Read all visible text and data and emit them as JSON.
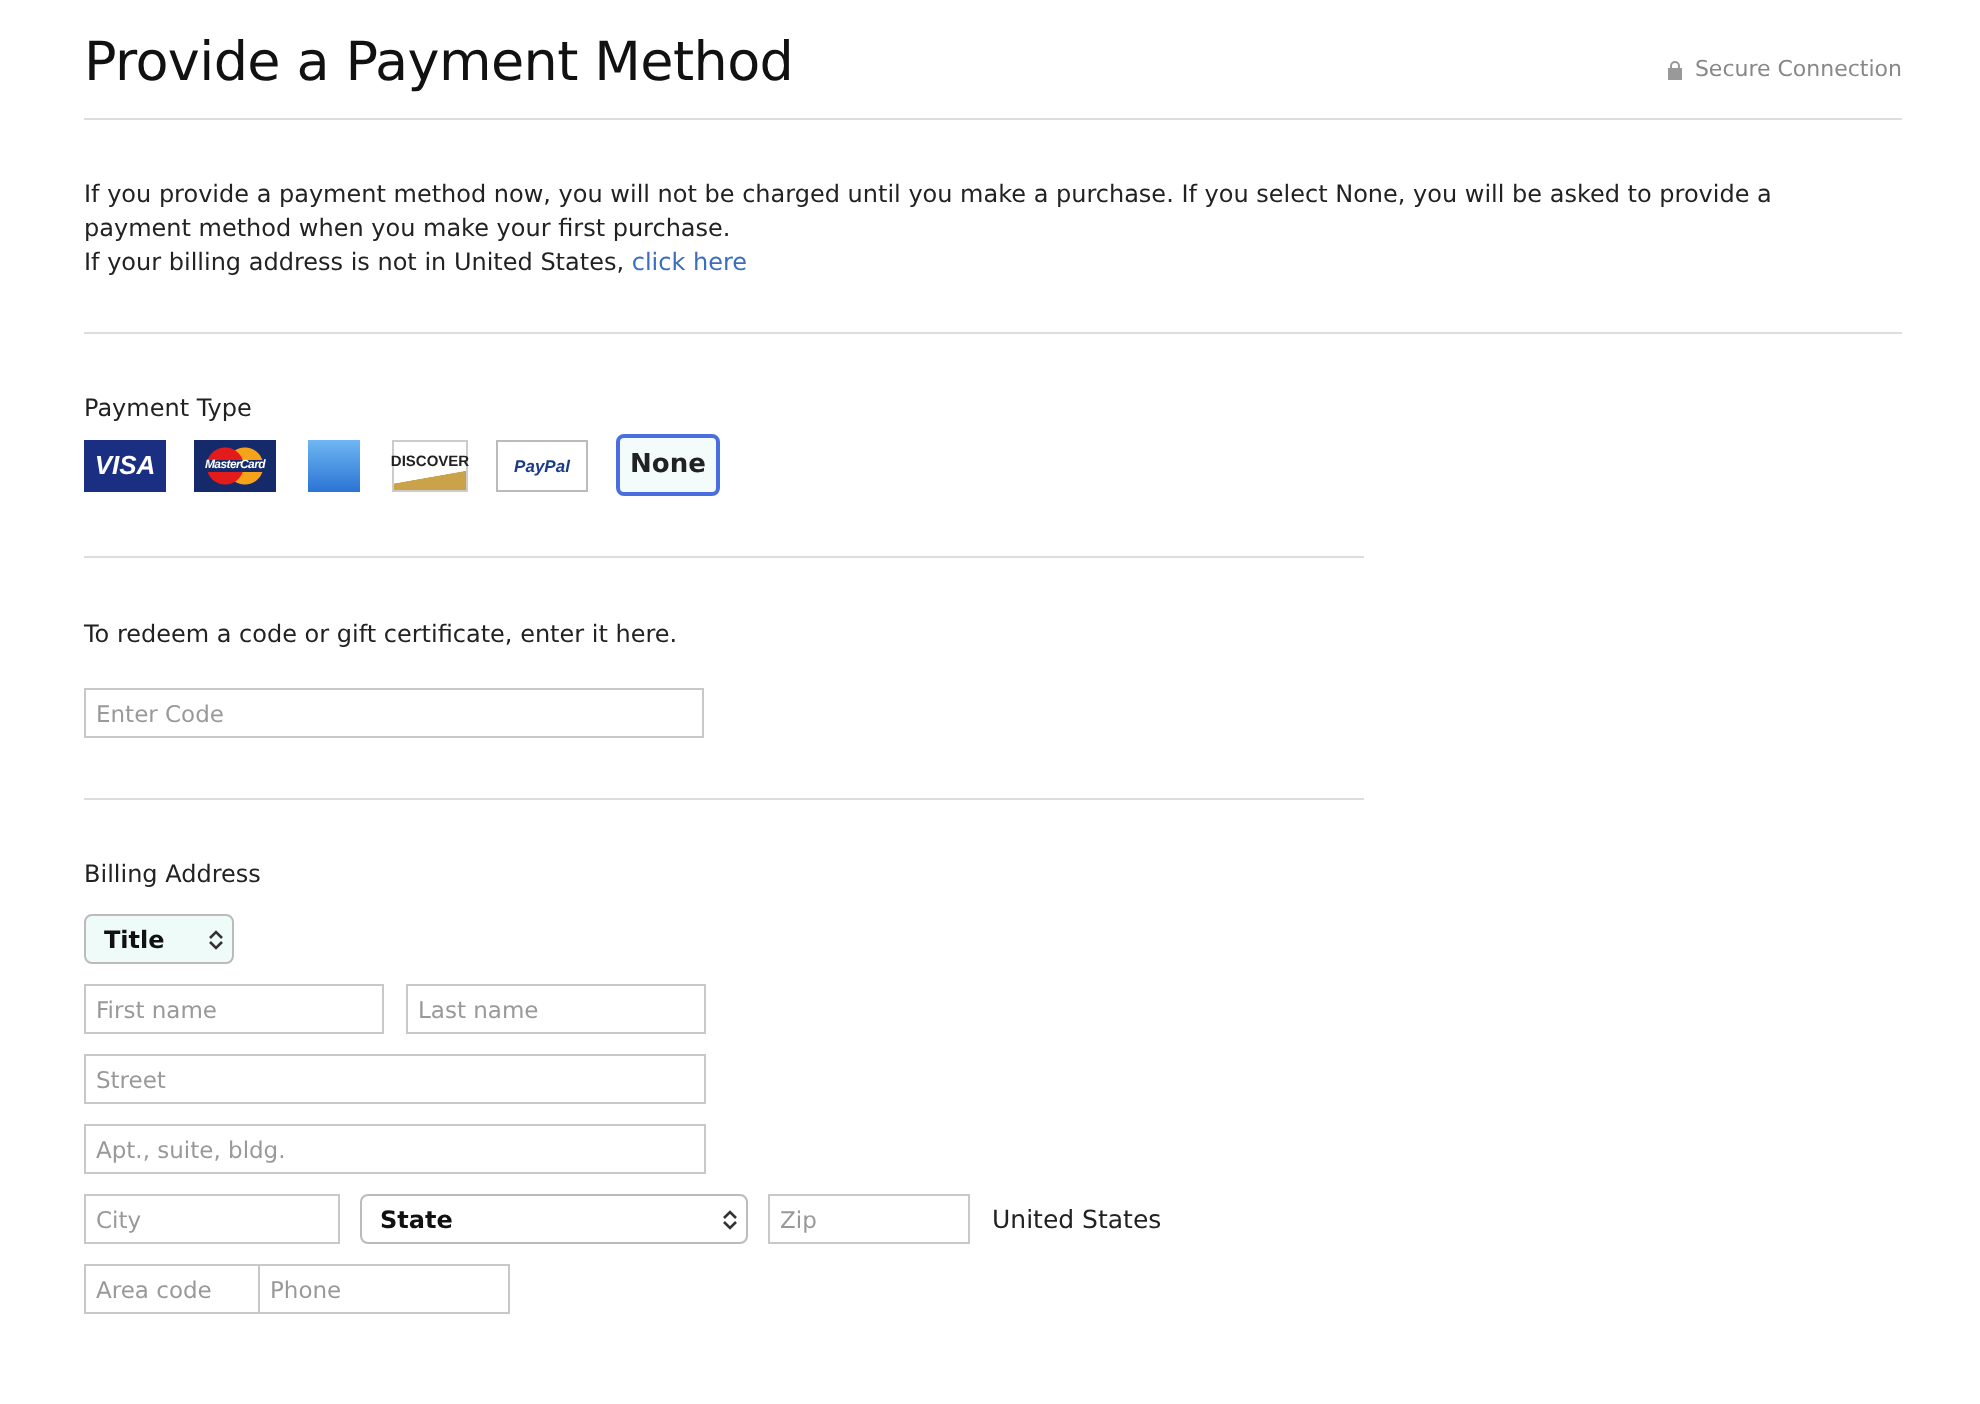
{
  "header": {
    "title": "Provide a Payment Method",
    "secure": "Secure Connection"
  },
  "intro": {
    "text": "If you provide a payment method now, you will not be charged until you make a purchase. If you select None, you will be asked to provide a payment method when you make your first purchase.",
    "billing_note": "If your billing address is not in United States, ",
    "link": "click here"
  },
  "payment": {
    "label": "Payment Type",
    "options": [
      {
        "kind": "visa",
        "label": "VISA",
        "selected": false
      },
      {
        "kind": "mastercard",
        "label": "MasterCard",
        "selected": false
      },
      {
        "kind": "amex",
        "selected": false
      },
      {
        "kind": "discover",
        "label": "DISCOVER",
        "selected": false
      },
      {
        "kind": "paypal",
        "label": "PayPal",
        "selected": false
      },
      {
        "kind": "none",
        "label": "None",
        "selected": true
      }
    ]
  },
  "redeem": {
    "text": "To redeem a code or gift certificate, enter it here.",
    "placeholder": "Enter Code"
  },
  "billing": {
    "label": "Billing Address",
    "title_select": "Title",
    "first_name": {
      "placeholder": "First name"
    },
    "last_name": {
      "placeholder": "Last name"
    },
    "street": {
      "placeholder": "Street"
    },
    "apt": {
      "placeholder": "Apt., suite, bldg."
    },
    "city": {
      "placeholder": "City"
    },
    "state_select": "State",
    "zip": {
      "placeholder": "Zip"
    },
    "country": "United States",
    "area_code": {
      "placeholder": "Area code"
    },
    "phone": {
      "placeholder": "Phone"
    }
  }
}
